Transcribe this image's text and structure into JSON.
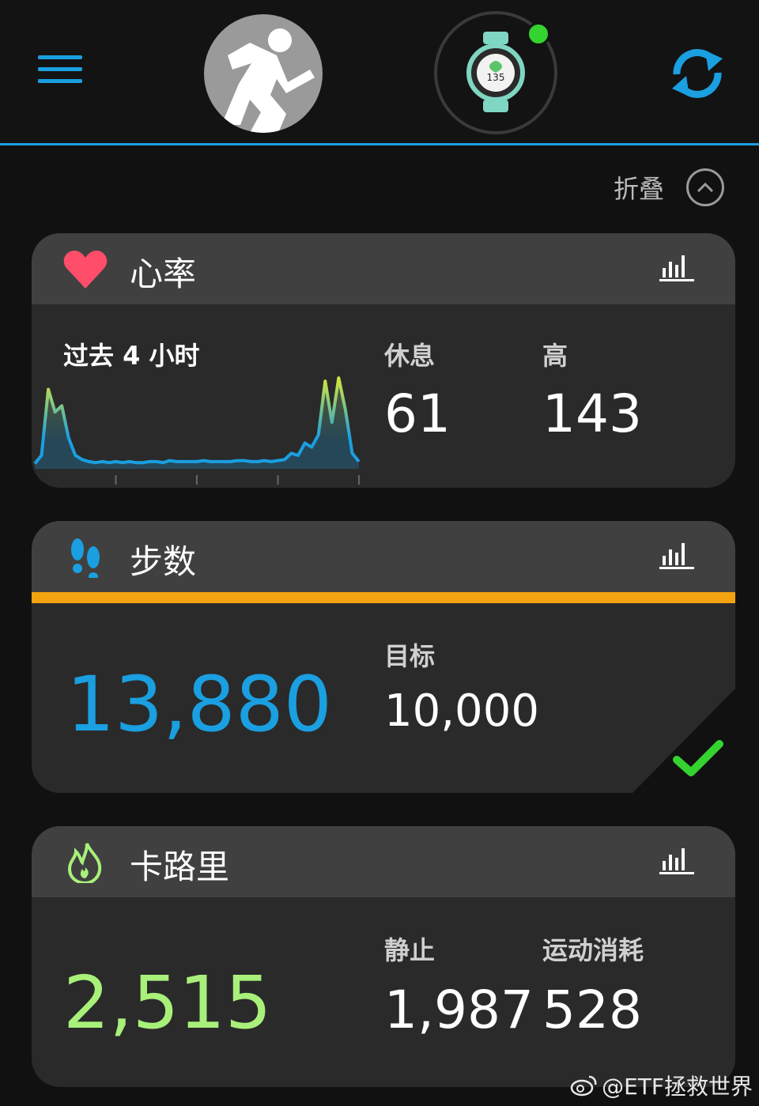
{
  "header": {
    "menu_icon": "hamburger-menu-icon",
    "activity_icon": "running-person-icon",
    "device_icon": "smartwatch-icon",
    "device_screen_value": "135",
    "connection_status_color": "#35d32f",
    "sync_icon": "sync-icon",
    "accent_color": "#1a9fe0"
  },
  "collapse": {
    "label": "折叠",
    "icon": "chevron-up-icon"
  },
  "heart_rate": {
    "title": "心率",
    "icon": "heart-icon",
    "icon_color": "#ff4d6a",
    "chart_label": "过去 4 小时",
    "resting_label": "休息",
    "resting_value": "61",
    "high_label": "高",
    "high_value": "143",
    "stats_icon": "bar-chart-icon"
  },
  "chart_data": {
    "type": "area",
    "x": [
      0,
      5,
      10,
      15,
      20,
      25,
      30,
      35,
      40,
      45,
      50,
      55,
      60,
      65,
      70,
      75,
      80,
      85,
      90,
      95,
      100,
      105,
      110,
      115,
      120,
      125,
      130,
      135,
      140,
      145,
      150,
      155,
      160,
      165,
      170,
      175,
      180,
      185,
      190,
      195,
      200,
      205,
      210,
      215,
      220,
      225,
      230,
      235,
      240
    ],
    "y": [
      60,
      68,
      132,
      110,
      116,
      85,
      68,
      64,
      62,
      61,
      62,
      61,
      62,
      61,
      62,
      61,
      61,
      62,
      62,
      61,
      63,
      62,
      62,
      62,
      62,
      63,
      62,
      62,
      62,
      62,
      63,
      63,
      62,
      62,
      63,
      62,
      63,
      64,
      70,
      68,
      80,
      76,
      88,
      140,
      100,
      143,
      112,
      70,
      62
    ],
    "ylim": [
      55,
      150
    ],
    "gradient_colors": [
      "#1a9fe0",
      "#d6e63a"
    ],
    "grid": false
  },
  "steps": {
    "title": "步数",
    "icon": "footprints-icon",
    "icon_color": "#1a9fe0",
    "progress_color": "#f3a30f",
    "progress": 1.0,
    "value": "13,880",
    "value_color": "#1a9fe0",
    "goal_label": "目标",
    "goal_value": "10,000",
    "goal_met_icon": "checkmark-icon",
    "stats_icon": "bar-chart-icon"
  },
  "calories": {
    "title": "卡路里",
    "icon": "flame-icon",
    "icon_color": "#a8f07a",
    "value": "2,515",
    "value_color": "#a8f07a",
    "resting_label": "静止",
    "resting_value": "1,987",
    "active_label": "运动消耗",
    "active_value": "528",
    "stats_icon": "bar-chart-icon"
  },
  "watermark": {
    "text": "@ETF拯救世界",
    "icon": "weibo-icon"
  }
}
